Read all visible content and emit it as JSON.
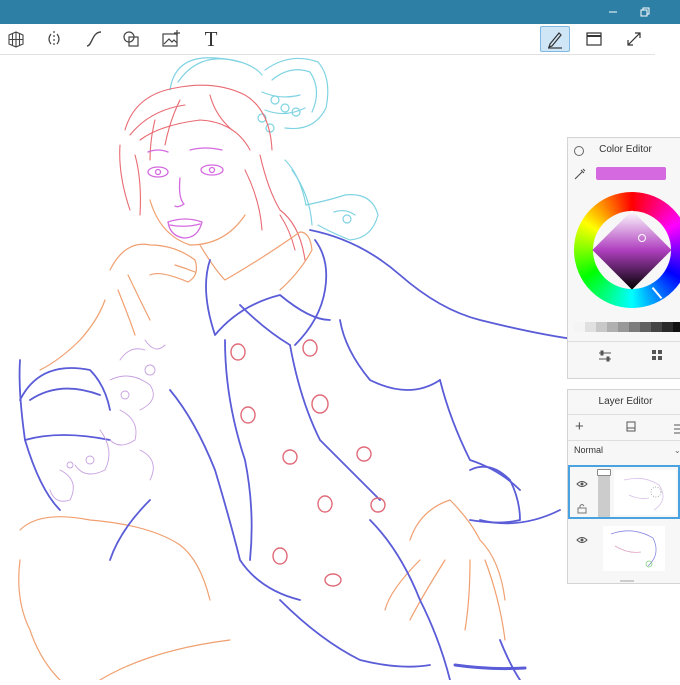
{
  "app": {
    "window_controls": [
      "minimize-icon",
      "restore-icon"
    ],
    "accent_color": "#2e7fa6"
  },
  "toolbar": {
    "tools": [
      "perspective-grid-icon",
      "symmetry-icon",
      "curve-stroke-icon",
      "shapes-icon",
      "insert-image-icon",
      "text-icon"
    ],
    "text_tool_glyph": "T",
    "right_tools": [
      "pen-icon",
      "window-icon",
      "fullscreen-icon"
    ]
  },
  "color_editor": {
    "title": "Color Editor",
    "current_color": "#d469e0"
  },
  "layer_editor": {
    "title": "Layer Editor",
    "blend_mode": "Normal"
  }
}
